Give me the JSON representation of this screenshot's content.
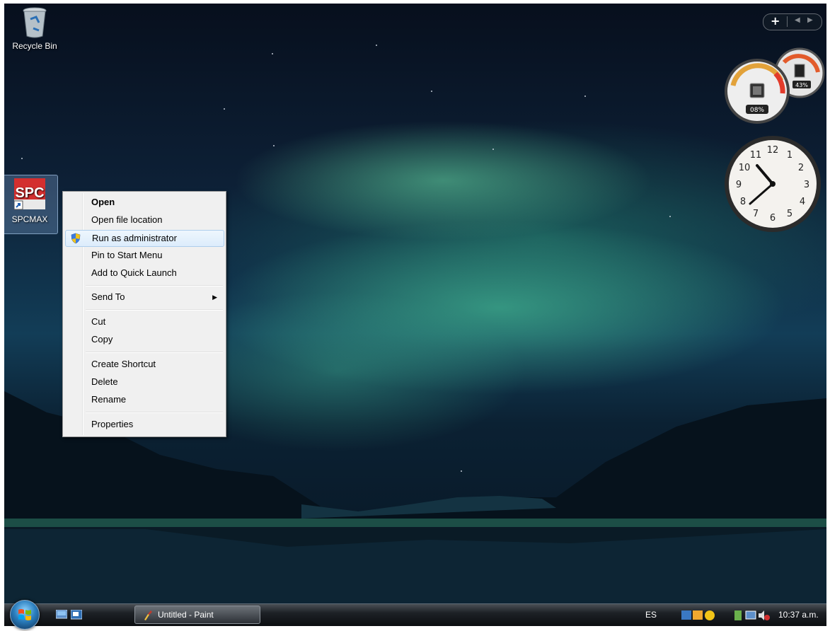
{
  "desktop": {
    "icons": [
      {
        "label": "Recycle Bin"
      },
      {
        "label": "SPCMAX"
      }
    ],
    "gadgets": {
      "cpu_percent": "08%",
      "memory_percent": "43%",
      "clock_numerals": [
        "12",
        "1",
        "2",
        "3",
        "4",
        "5",
        "6",
        "7",
        "8",
        "9",
        "10",
        "11"
      ]
    }
  },
  "context_menu": {
    "items": [
      {
        "label": "Open",
        "bold": true
      },
      {
        "label": "Open file location"
      },
      {
        "label": "Run as administrator",
        "icon": "uac-shield-icon",
        "highlighted": true
      },
      {
        "label": "Pin to Start Menu"
      },
      {
        "label": "Add to Quick Launch"
      },
      {
        "label": "Send To",
        "submenu": true
      },
      {
        "label": "Cut"
      },
      {
        "label": "Copy"
      },
      {
        "label": "Create Shortcut"
      },
      {
        "label": "Delete"
      },
      {
        "label": "Rename"
      },
      {
        "label": "Properties"
      }
    ]
  },
  "taskbar": {
    "window_button": "Untitled - Paint",
    "language": "ES",
    "time": "10:37 a.m."
  },
  "colors": {
    "menu_highlight": "#dcecfc",
    "taskbar": "#1d2126",
    "aurora": "#46be96"
  }
}
